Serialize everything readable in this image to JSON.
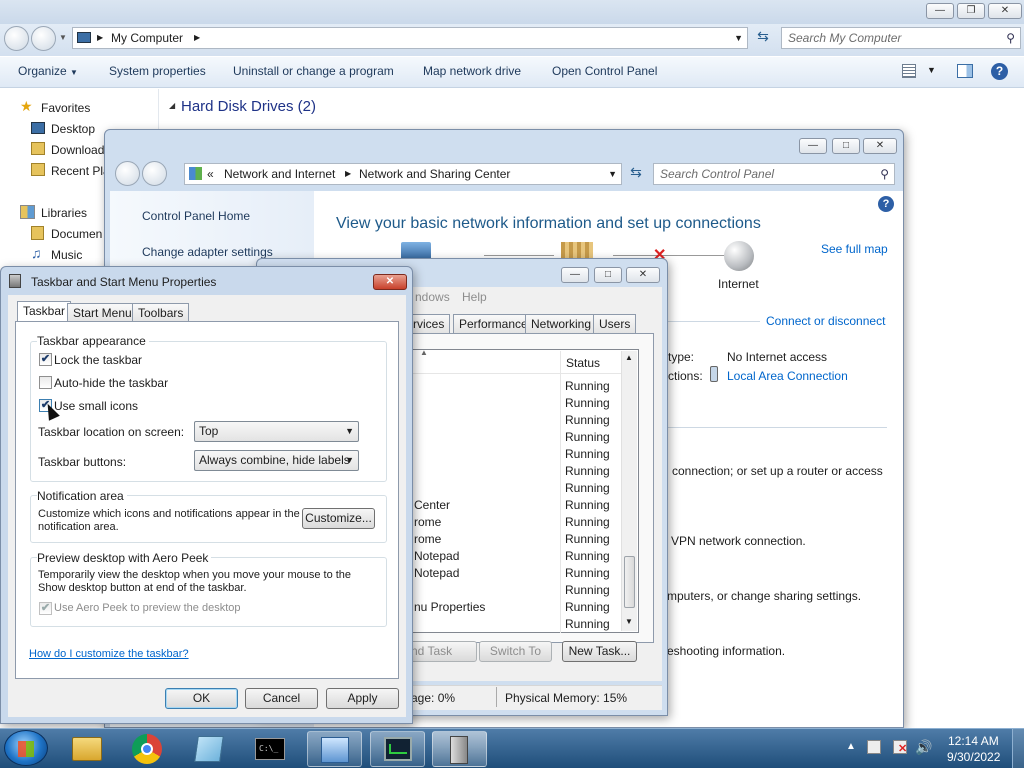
{
  "explorer": {
    "address": [
      "My Computer"
    ],
    "search_placeholder": "Search My Computer",
    "toolbar": [
      "Organize",
      "System properties",
      "Uninstall or change a program",
      "Map network drive",
      "Open Control Panel"
    ],
    "sidebar": {
      "favorites_label": "Favorites",
      "favorites": [
        "Desktop",
        "Download",
        "Recent Pla"
      ],
      "libraries_label": "Libraries",
      "libraries": [
        "Documen",
        "Music"
      ]
    },
    "section_header": "Hard Disk Drives (2)"
  },
  "control_panel": {
    "breadcrumb_root": "«",
    "breadcrumb": [
      "Network and Internet",
      "Network and Sharing Center"
    ],
    "search_placeholder": "Search Control Panel",
    "left_links": [
      "Control Panel Home",
      "Change adapter settings"
    ],
    "heading": "View your basic network information and set up connections",
    "see_full_map": "See full map",
    "internet_label": "Internet",
    "connect_disconnect": "Connect or disconnect",
    "access_type_label": "type:",
    "access_type_value": "No Internet access",
    "connections_label": "ctions:",
    "connections_value": "Local Area Connection",
    "snippets": [
      "connection; or set up a router or access",
      "VPN network connection.",
      "mputers, or change sharing settings.",
      "eshooting information."
    ]
  },
  "task_manager": {
    "menu_partial": "ndows",
    "menu_help": "Help",
    "tabs": [
      "rvices",
      "Performance",
      "Networking",
      "Users"
    ],
    "status_header": "Status",
    "rows": [
      {
        "name": "",
        "status": "Running"
      },
      {
        "name": "",
        "status": "Running"
      },
      {
        "name": "",
        "status": "Running"
      },
      {
        "name": "",
        "status": "Running"
      },
      {
        "name": "",
        "status": "Running"
      },
      {
        "name": "",
        "status": "Running"
      },
      {
        "name": "",
        "status": "Running"
      },
      {
        "name": "Center",
        "status": "Running"
      },
      {
        "name": "rome",
        "status": "Running"
      },
      {
        "name": "rome",
        "status": "Running"
      },
      {
        "name": "Notepad",
        "status": "Running"
      },
      {
        "name": "Notepad",
        "status": "Running"
      },
      {
        "name": "",
        "status": "Running"
      },
      {
        "name": "nu Properties",
        "status": "Running"
      },
      {
        "name": "",
        "status": "Running"
      }
    ],
    "end_task": "nd Task",
    "switch_to": "Switch To",
    "new_task": "New Task...",
    "status_cpu": "age: 0%",
    "status_mem": "Physical Memory: 15%"
  },
  "taskbar_props": {
    "title": "Taskbar and Start Menu Properties",
    "tabs": [
      "Taskbar",
      "Start Menu",
      "Toolbars"
    ],
    "appearance_label": "Taskbar appearance",
    "lock": {
      "label": "Lock the taskbar",
      "checked": true
    },
    "autohide": {
      "label": "Auto-hide the taskbar",
      "checked": false
    },
    "small_icons": {
      "label": "Use small icons",
      "checked": true
    },
    "location_label": "Taskbar location on screen:",
    "location_value": "Top",
    "buttons_label": "Taskbar buttons:",
    "buttons_value": "Always combine, hide labels",
    "notif_label": "Notification area",
    "notif_text": "Customize which icons and notifications appear in the notification area.",
    "customize_btn": "Customize...",
    "peek_label": "Preview desktop with Aero Peek",
    "peek_text": "Temporarily view the desktop when you move your mouse to the Show desktop button at end of the taskbar.",
    "peek_check": {
      "label": "Use Aero Peek to preview the desktop",
      "checked": true
    },
    "help_link": "How do I customize the taskbar?",
    "ok": "OK",
    "cancel": "Cancel",
    "apply": "Apply"
  },
  "taskbar": {
    "time": "12:14 AM",
    "date": "9/30/2022"
  },
  "colors": {
    "taskbar": "#2a5f8f",
    "link": "#0066cc",
    "heading": "#1e5a8a",
    "close_red": "#c8412b"
  }
}
